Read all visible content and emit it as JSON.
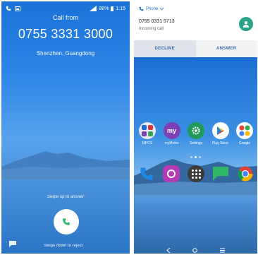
{
  "incoming_call_screen": {
    "status_bar": {
      "battery": "88%",
      "time": "1:15"
    },
    "caption": "Call from",
    "number": "0755 3331 3000",
    "location": "Shenzhen, Guangdong",
    "swipe_up_hint": "Swipe up to answer",
    "swipe_down_hint": "Swipe down to reject"
  },
  "heads_up_notification": {
    "app_name": "Phone",
    "number": "0755 0331 5713",
    "status": "Incoming call",
    "decline_label": "DECLINE",
    "answer_label": "ANSWER"
  },
  "home_screen": {
    "apps": [
      {
        "label": "MPCS"
      },
      {
        "label": "myMetro"
      },
      {
        "label": "Settings"
      },
      {
        "label": "Play Store"
      },
      {
        "label": "Google"
      }
    ],
    "page_indicator": {
      "pages": 3,
      "current": 2
    },
    "dock": [
      "phone-icon",
      "camera-icon",
      "app-drawer-icon",
      "messages-icon",
      "chrome-icon"
    ]
  },
  "colors": {
    "call_background": "#2f86e6",
    "answer_green": "#2fb865",
    "notification_accent": "#1e6fd0",
    "avatar": "#2aa38b"
  }
}
